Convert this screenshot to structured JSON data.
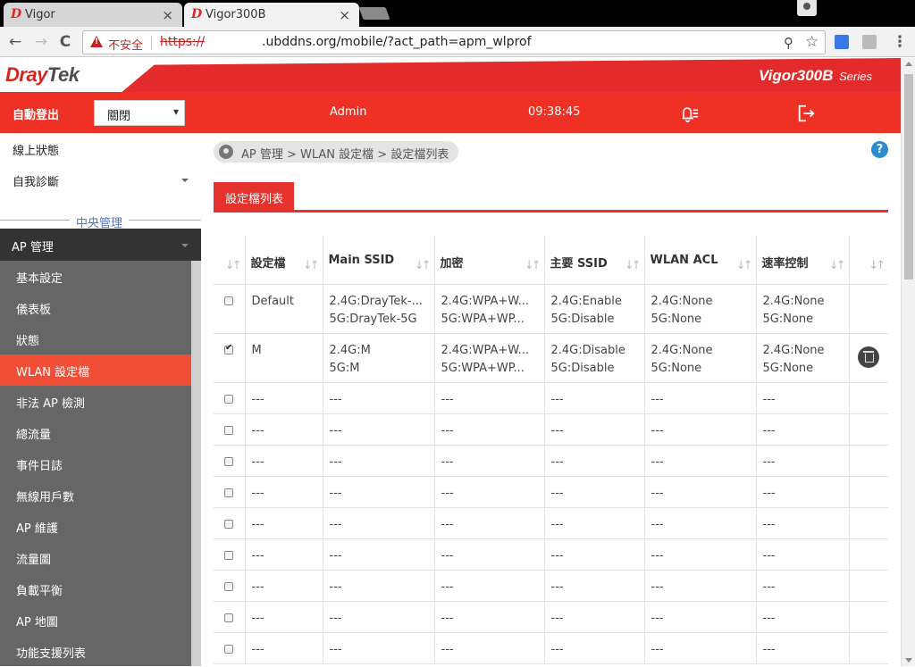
{
  "browser": {
    "tabs": [
      {
        "title": "Vigor",
        "favicon": "draytek-d-icon",
        "favicon_glyph": "D",
        "close": "×"
      },
      {
        "title": "Vigor300B",
        "favicon": "draytek-d-icon",
        "favicon_glyph": "D",
        "close": "×"
      }
    ],
    "nav": {
      "back": "←",
      "forward": "→",
      "reload": "C"
    },
    "security_label": "不安全",
    "url_scheme": "https://",
    "url_rest": ".ubddns.org/mobile/?act_path=apm_wlprof",
    "zoom_icon": "⚲",
    "star_icon": "☆",
    "menu_icon": "⋮"
  },
  "header": {
    "logo_main": "Dray",
    "logo_accent": "Tek",
    "model": "Vigor300B",
    "model_suffix": "Series",
    "auto_logout_label": "自動登出",
    "auto_logout_value": "關閉",
    "user": "Admin",
    "time": "09:38:45"
  },
  "sidebar": {
    "top_items": [
      {
        "label": "線上狀態"
      },
      {
        "label": "自我診斷"
      }
    ],
    "section_label": "中央管理",
    "group_label": "AP 管理",
    "items": [
      {
        "label": "基本設定",
        "active": false
      },
      {
        "label": "儀表板",
        "active": false
      },
      {
        "label": "狀態",
        "active": false
      },
      {
        "label": "WLAN 設定檔",
        "active": true
      },
      {
        "label": "非法 AP 檢測",
        "active": false
      },
      {
        "label": "總流量",
        "active": false
      },
      {
        "label": "事件日誌",
        "active": false
      },
      {
        "label": "無線用戶數",
        "active": false
      },
      {
        "label": "AP 維護",
        "active": false
      },
      {
        "label": "流量圖",
        "active": false
      },
      {
        "label": "負載平衡",
        "active": false
      },
      {
        "label": "AP 地圖",
        "active": false
      },
      {
        "label": "功能支援列表",
        "active": false
      }
    ]
  },
  "main": {
    "breadcrumb": "AP 管理  >  WLAN 設定檔  >  設定檔列表",
    "help": "?",
    "tab_label": "設定檔列表",
    "sort_glyph": "↓↑",
    "table": {
      "headers": [
        "設定檔",
        "Main SSID",
        "加密",
        "主要 SSID",
        "WLAN ACL",
        "速率控制"
      ],
      "rows": [
        {
          "checked": false,
          "profile": "Default",
          "main_ssid": [
            "2.4G:DrayTek-...",
            "5G:DrayTek-5G"
          ],
          "encryption": [
            "2.4G:WPA+W...",
            "5G:WPA+WP..."
          ],
          "primary_ssid": [
            "2.4G:Enable",
            "5G:Disable"
          ],
          "acl": [
            "2.4G:None",
            "5G:None"
          ],
          "rate": [
            "2.4G:None",
            "5G:None"
          ],
          "deletable": false
        },
        {
          "checked": true,
          "profile": "M",
          "main_ssid": [
            "2.4G:M",
            "5G:M"
          ],
          "encryption": [
            "2.4G:WPA+W...",
            "5G:WPA+WP..."
          ],
          "primary_ssid": [
            "2.4G:Disable",
            "5G:Disable"
          ],
          "acl": [
            "2.4G:None",
            "5G:None"
          ],
          "rate": [
            "2.4G:None",
            "5G:None"
          ],
          "deletable": true
        }
      ],
      "empty_rows": 9,
      "empty_value": "---"
    }
  }
}
